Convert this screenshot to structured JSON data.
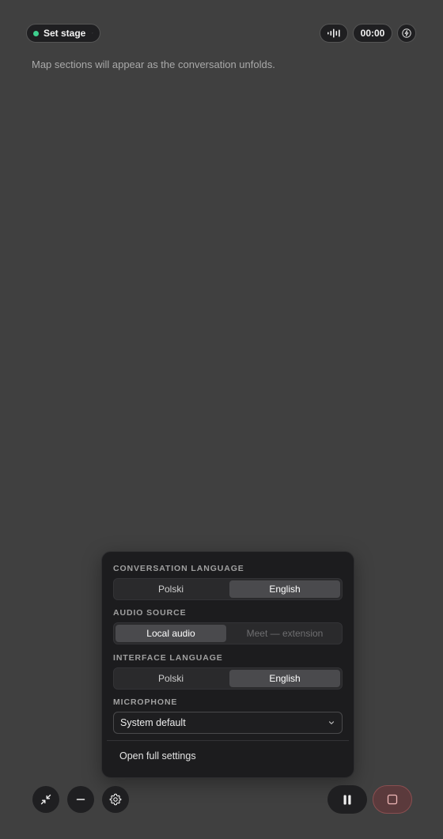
{
  "header": {
    "stage_label": "Set stage",
    "timer": "00:00",
    "icons": {
      "status": "status-dot",
      "stage_menu": "chevron-down-icon",
      "audio": "waveform-icon",
      "assist": "bolt-icon"
    },
    "status_color": "#3ecf8e"
  },
  "hint": "Map sections will appear as the conversation unfolds.",
  "settings": {
    "conversation_language": {
      "label": "CONVERSATION LANGUAGE",
      "options": [
        "Polski",
        "English"
      ],
      "selected": "English"
    },
    "audio_source": {
      "label": "AUDIO SOURCE",
      "options": [
        "Local audio",
        "Meet — extension"
      ],
      "selected": "Local audio"
    },
    "interface_language": {
      "label": "INTERFACE LANGUAGE",
      "options": [
        "Polski",
        "English"
      ],
      "selected": "English"
    },
    "microphone": {
      "label": "MICROPHONE",
      "value": "System default"
    },
    "open_full_settings": "Open full settings"
  },
  "footer": {
    "icons": [
      "collapse-icon",
      "minus-icon",
      "gear-icon",
      "pause-icon",
      "stop-icon"
    ],
    "stop_color": "#5b3a3c"
  }
}
